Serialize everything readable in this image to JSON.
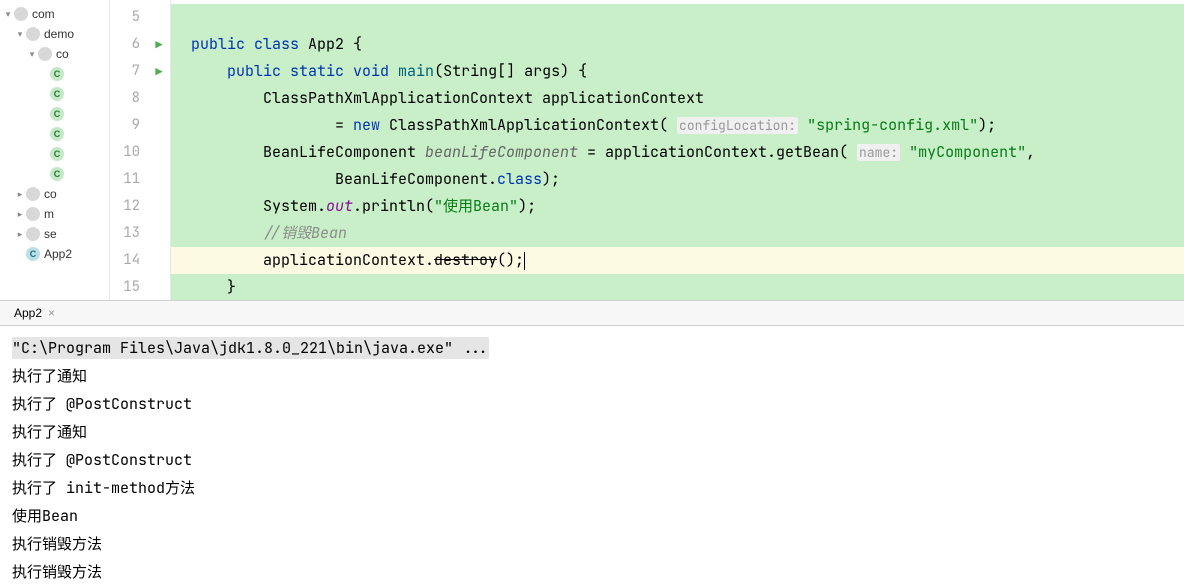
{
  "sidebar": {
    "items": [
      {
        "indent": 0,
        "arrow": "▾",
        "icon": "folder",
        "label": "com"
      },
      {
        "indent": 1,
        "arrow": "▾",
        "icon": "folder",
        "label": "demo"
      },
      {
        "indent": 2,
        "arrow": "▾",
        "icon": "folder",
        "label": "co"
      },
      {
        "indent": 3,
        "arrow": "",
        "icon": "class",
        "label": ""
      },
      {
        "indent": 3,
        "arrow": "",
        "icon": "class",
        "label": ""
      },
      {
        "indent": 3,
        "arrow": "",
        "icon": "class",
        "label": ""
      },
      {
        "indent": 3,
        "arrow": "",
        "icon": "class",
        "label": ""
      },
      {
        "indent": 3,
        "arrow": "",
        "icon": "class",
        "label": ""
      },
      {
        "indent": 3,
        "arrow": "",
        "icon": "class",
        "label": ""
      },
      {
        "indent": 1,
        "arrow": "▸",
        "icon": "folder",
        "label": "co"
      },
      {
        "indent": 1,
        "arrow": "▸",
        "icon": "folder",
        "label": "m"
      },
      {
        "indent": 1,
        "arrow": "▸",
        "icon": "folder",
        "label": "se"
      },
      {
        "indent": 1,
        "arrow": "",
        "icon": "classG",
        "label": "App2"
      }
    ]
  },
  "gutter": {
    "lines": [
      "5",
      "6",
      "7",
      "8",
      "9",
      "10",
      "11",
      "12",
      "13",
      "14",
      "15"
    ],
    "runnable": {
      "6": true,
      "7": true
    }
  },
  "code": {
    "l6": {
      "kw": "public class",
      "name": " App2 {"
    },
    "l7": {
      "kw1": "public static ",
      "kw2": "void ",
      "m": "main",
      "rest": "(String[] args) {"
    },
    "l8": "        ClassPathXmlApplicationContext applicationContext",
    "l9": {
      "pre": "                = ",
      "kw": "new",
      "mid": " ClassPathXmlApplicationContext( ",
      "plabel": "configLocation:",
      "str": "\"spring-config.xml\"",
      "end": ");"
    },
    "l10": {
      "pre": "        BeanLifeComponent ",
      "var": "beanLifeComponent",
      "mid": " = applicationContext.getBean( ",
      "plabel": "name:",
      "str": "\"myComponent\"",
      "end": ","
    },
    "l11": {
      "pre": "                BeanLifeComponent.",
      "kw": "class",
      "end": ");"
    },
    "l12": {
      "pre": "        System.",
      "field": "out",
      "mid": ".println(",
      "str": "\"使用Bean\"",
      "end": ");"
    },
    "l13": "        //销毁Bean",
    "l14": {
      "pre": "        applicationContext.",
      "strike": "destroy",
      "end": "();"
    },
    "l15": "    }"
  },
  "tab": {
    "name": "App2"
  },
  "console": {
    "cmd": "\"C:\\Program Files\\Java\\jdk1.8.0_221\\bin\\java.exe\" ...",
    "lines": [
      "执行了通知",
      "执行了 @PostConstruct",
      "执行了通知",
      "执行了 @PostConstruct",
      "执行了 init-method方法",
      "使用Bean",
      "执行销毁方法",
      "执行销毁方法"
    ]
  }
}
